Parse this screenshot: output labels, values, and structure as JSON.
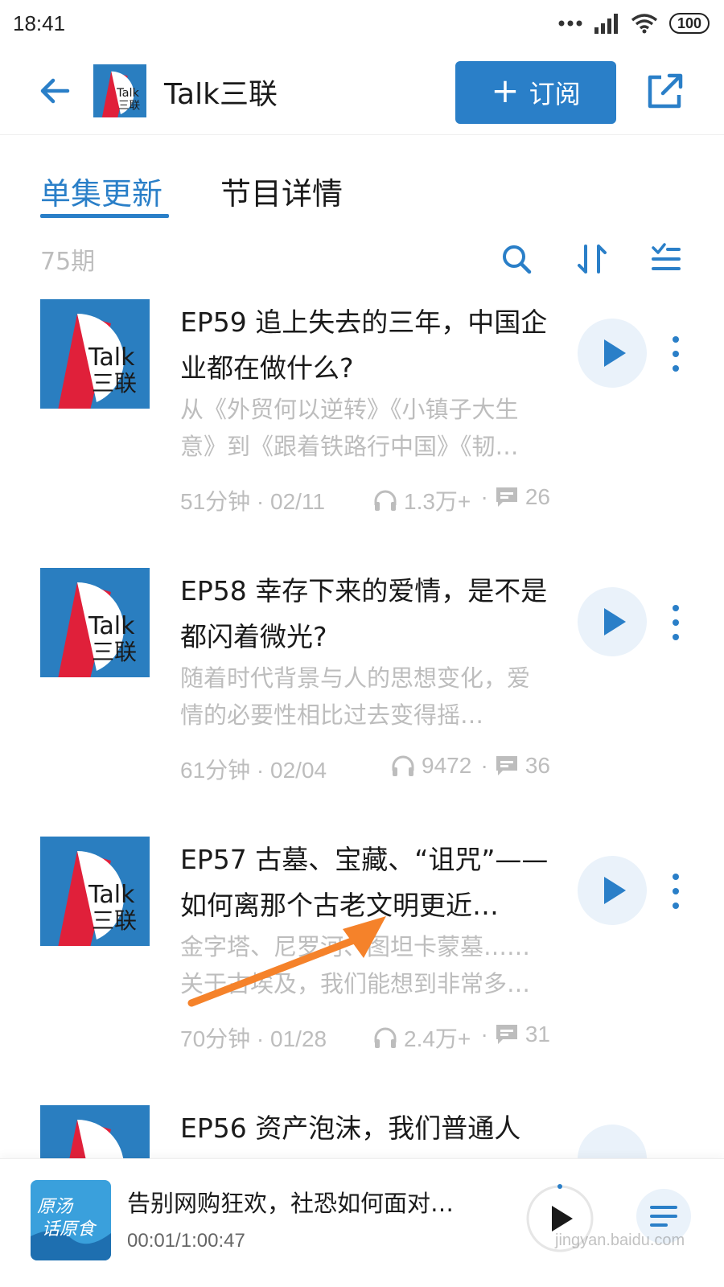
{
  "status_bar": {
    "time": "18:41",
    "battery": "100"
  },
  "header": {
    "title": "Talk三联",
    "subscribe_label": "订阅"
  },
  "tabs": {
    "active": "单集更新",
    "inactive": "节目详情"
  },
  "toolbar": {
    "episode_count": "75期"
  },
  "cover_text": {
    "line1": "Talk",
    "line2": "三联"
  },
  "episodes": [
    {
      "title": "EP59 追上失去的三年，中国企业都在做什么?",
      "description": "从《外贸何以逆转》《小镇子大生意》到《跟着铁路行中国》《韧…",
      "duration_date": "51分钟 · 02/11",
      "plays": "1.3万+",
      "comments": "26"
    },
    {
      "title": "EP58 幸存下来的爱情，是不是都闪着微光?",
      "description": "随着时代背景与人的思想变化，爱情的必要性相比过去变得摇…",
      "duration_date": "61分钟 · 02/04",
      "plays": "9472",
      "comments": "36"
    },
    {
      "title": "EP57 古墓、宝藏、“诅咒”——如何离那个古老文明更近…",
      "description": "金字塔、尼罗河、图坦卡蒙墓……关于古埃及，我们能想到非常多…",
      "duration_date": "70分钟 · 01/28",
      "plays": "2.4万+",
      "comments": "31"
    },
    {
      "title": "EP56 资产泡沫，我们普通人",
      "description": "",
      "duration_date": "",
      "plays": "",
      "comments": ""
    }
  ],
  "mini_player": {
    "title": "告别网购狂欢，社恐如何面对…",
    "time": "00:01/1:00:47",
    "cover_text_1": "原汤",
    "cover_text_2": "话原食"
  },
  "watermark": "jingyan.baidu.com",
  "colors": {
    "accent": "#2a7fc8",
    "cover_blue": "#2a7ec0",
    "cover_red": "#e0203a",
    "annotation": "#f5822a"
  }
}
